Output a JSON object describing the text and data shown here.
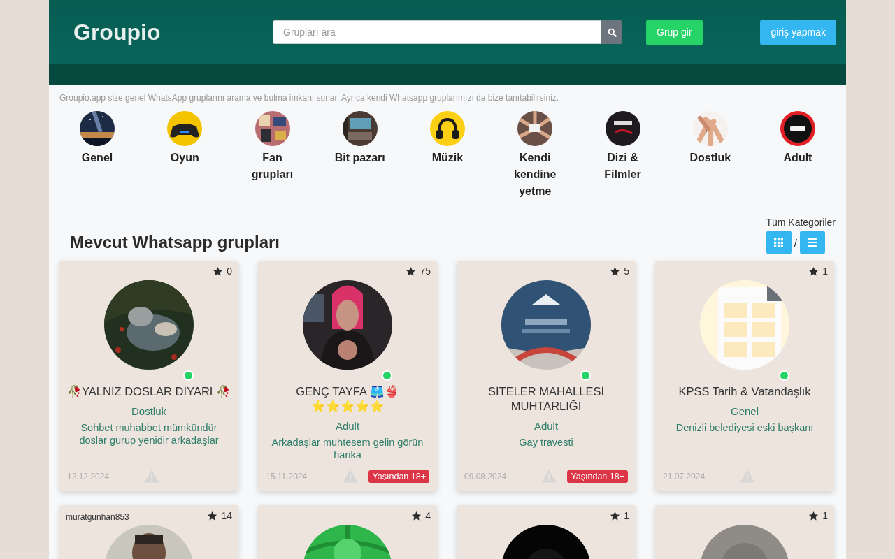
{
  "header": {
    "logo": "Groupio",
    "search": {
      "placeholder": "Grupları ara"
    },
    "buttons": [
      {
        "label": "Grup gir",
        "kind": "primary"
      },
      {
        "label": "giriş yapmak",
        "kind": "info"
      }
    ]
  },
  "intro": "Groupio.app size genel WhatsApp gruplarını arama ve bulma imkanı sunar. Ayrıca kendi Whatsapp gruplarımızı da bize tanıtabilirsiniz.",
  "categories": [
    {
      "label": "Genel"
    },
    {
      "label": "Oyun"
    },
    {
      "label": "Fan grupları"
    },
    {
      "label": "Bit pazarı"
    },
    {
      "label": "Müzik"
    },
    {
      "label": "Kendi kendine yetme"
    },
    {
      "label": "Dizi & Filmler"
    },
    {
      "label": "Dostluk"
    },
    {
      "label": "Adult"
    }
  ],
  "all_categories_link": "Tüm Kategoriler",
  "section_title": "Mevcut Whatsapp grupları",
  "view_toggle": {
    "separator": "/"
  },
  "groups": [
    {
      "rating": "0",
      "online": true,
      "name": "🥀YALNIZ DOSLAR DİYARI 🥀",
      "category": "Dostluk",
      "description": "Sohbet muhabbet mümkündür doslar gurup yenidir arkadaşlar",
      "date": "12.12.2024"
    },
    {
      "rating": "75",
      "online": true,
      "name": "GENÇ TAYFA 🩳👙 ⭐⭐⭐⭐⭐",
      "category": "Adult",
      "description": "Arkadaşlar muhtesem gelin görün harika",
      "date": "15.11.2024",
      "badge": "Yaşından 18+"
    },
    {
      "rating": "5",
      "online": true,
      "name": "SİTELER MAHALLESİ MUHTARLIĞI",
      "category": "Adult",
      "description": "Gay travesti",
      "date": "09.08.2024",
      "badge": "Yaşından 18+"
    },
    {
      "rating": "1",
      "online": true,
      "name": "KPSS Tarih & Vatandaşlık",
      "category": "Genel",
      "description": "Denizli belediyesi eski başkanı",
      "date": "21.07.2024"
    },
    {
      "rating": "14",
      "username": "muratgunhan853"
    },
    {
      "rating": "4"
    },
    {
      "rating": "1"
    },
    {
      "rating": "1"
    }
  ]
}
